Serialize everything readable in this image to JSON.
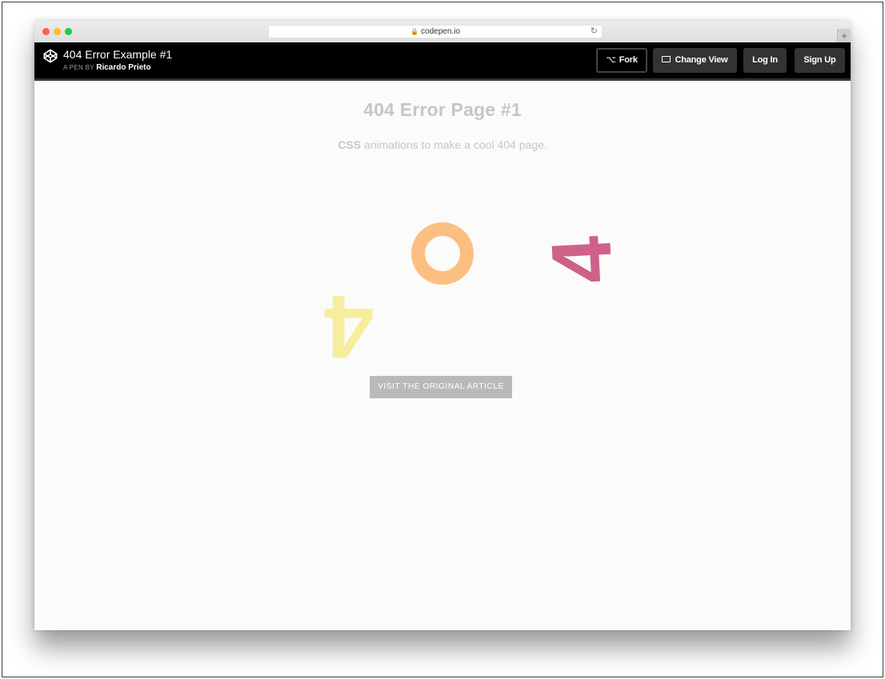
{
  "browser": {
    "url": "codepen.io",
    "new_tab_label": "+"
  },
  "header": {
    "pen_title": "404 Error Example #1",
    "by_label": "A PEN BY",
    "author": "Ricardo Prieto",
    "buttons": {
      "fork": "Fork",
      "change_view": "Change View",
      "log_in": "Log In",
      "sign_up": "Sign Up"
    }
  },
  "main": {
    "title": "404 Error Page #1",
    "subtitle_strong": "CSS",
    "subtitle_rest": " animations to make a cool 404 page.",
    "digits": [
      "4",
      "0",
      "4"
    ],
    "cta_label": "VISIT THE ORIGINAL ARTICLE"
  },
  "colors": {
    "header_bg": "#000000",
    "title_gray": "#c6c6c6",
    "digit_yellow": "#f7ee9d",
    "digit_orange": "#fcbf82",
    "digit_magenta": "#cd6189",
    "cta_bg": "#b9b9b9"
  }
}
